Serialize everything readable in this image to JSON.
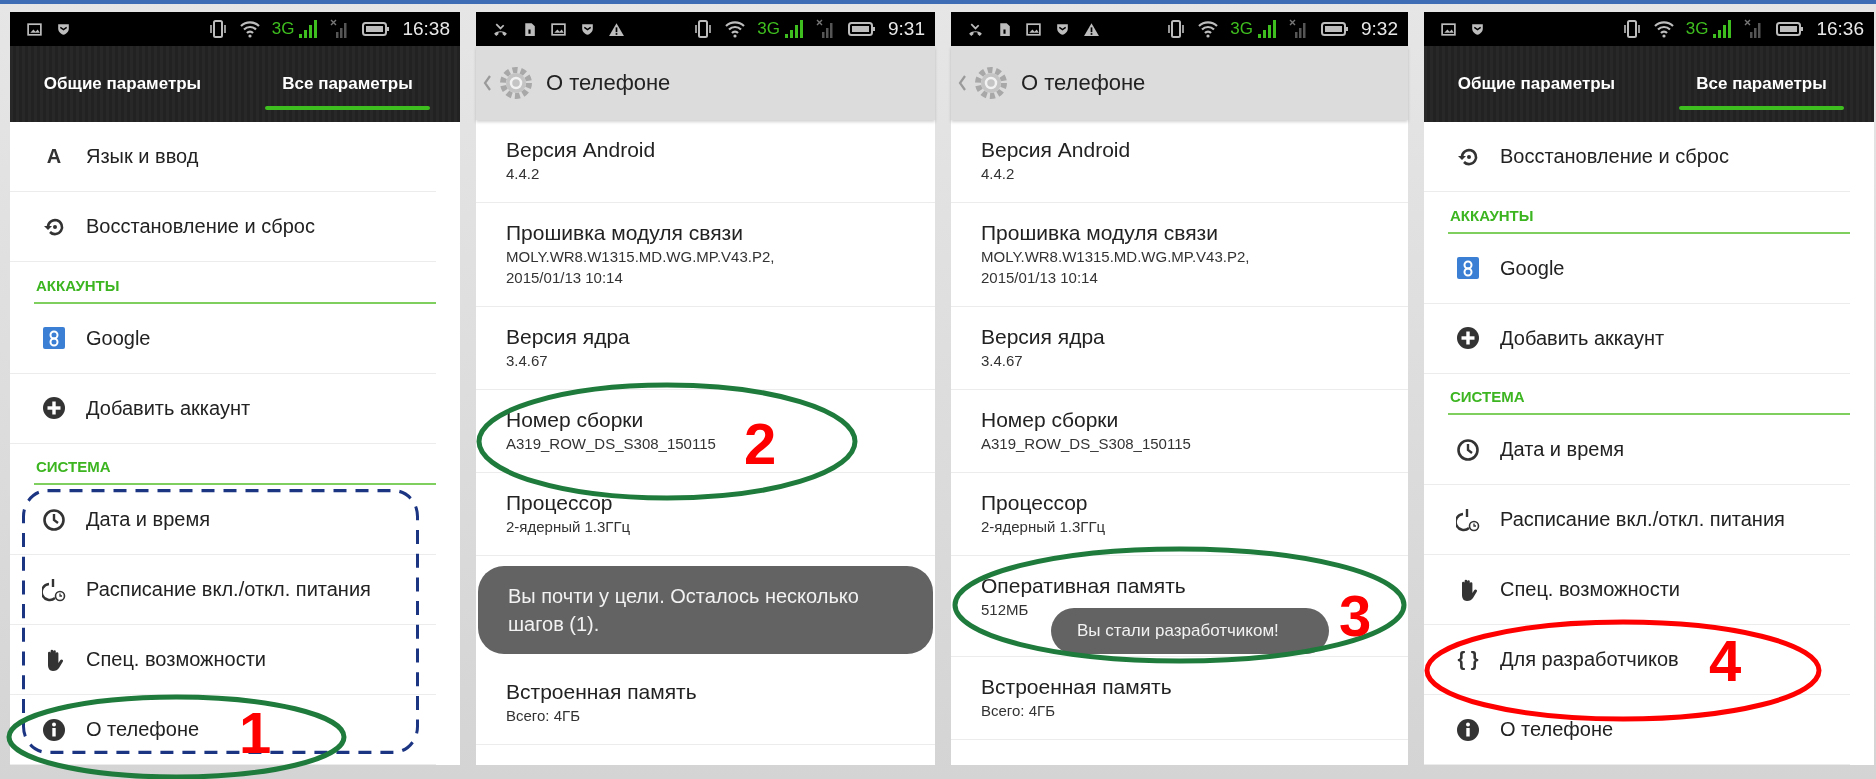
{
  "phones": [
    {
      "status_bar": {
        "notification_icons": [
          {
            "kind": "image"
          },
          {
            "kind": "shield"
          }
        ],
        "network": "3G",
        "time": "16:38"
      },
      "tabs": [
        {
          "label": "Общие параметры",
          "selected": false
        },
        {
          "label": "Все параметры",
          "selected": true
        }
      ],
      "items": [
        {
          "kind": "glyph",
          "glyph": "A",
          "label": "Язык и ввод"
        },
        {
          "kind": "restore",
          "label": "Восстановление и сброс"
        },
        {
          "kind": "section",
          "label": "АККАУНТЫ"
        },
        {
          "kind": "google",
          "label": "Google"
        },
        {
          "kind": "add",
          "label": "Добавить аккаунт"
        },
        {
          "kind": "section",
          "label": "СИСТЕМА"
        },
        {
          "kind": "group",
          "children": [
            {
              "kind": "clock",
              "label": "Дата и время"
            },
            {
              "kind": "schedule",
              "label": "Расписание вкл./откл. питания"
            },
            {
              "kind": "hand",
              "label": "Спец. возможности"
            },
            {
              "kind": "about",
              "label": "О телефоне",
              "annotation": {
                "color": "#1e7b3c",
                "number": "1"
              }
            }
          ]
        }
      ]
    },
    {
      "status_bar": {
        "notification_icons": [
          {
            "kind": "missed-call"
          },
          {
            "kind": "sd-card"
          },
          {
            "kind": "image"
          },
          {
            "kind": "shield"
          },
          {
            "kind": "warning"
          }
        ],
        "network": "3G",
        "time": "9:31"
      },
      "header": {
        "title": "О телефоне"
      },
      "items": [
        {
          "kind": "detail",
          "title": "Версия Android",
          "lines": [
            "4.4.2"
          ]
        },
        {
          "kind": "detail",
          "title": "Прошивка модуля связи",
          "lines": [
            "MOLY.WR8.W1315.MD.WG.MP.V43.P2,",
            "2015/01/13 10:14"
          ]
        },
        {
          "kind": "detail",
          "title": "Версия ядра",
          "lines": [
            "3.4.67"
          ]
        },
        {
          "kind": "detail",
          "title": "Номер сборки",
          "lines": [
            "A319_ROW_DS_S308_150115"
          ],
          "annotation": {
            "color": "#1e7b3c",
            "number": "2"
          }
        },
        {
          "kind": "detail",
          "title": "Процессор",
          "lines": [
            "2-ядерный 1.3ГГц"
          ]
        },
        {
          "kind": "toast",
          "text": "Вы почти у цели. Осталось несколько шагов (1)."
        },
        {
          "kind": "detail",
          "title": "Встроенная память",
          "lines": [
            "Всего: 4ГБ"
          ]
        }
      ]
    },
    {
      "status_bar": {
        "notification_icons": [
          {
            "kind": "missed-call"
          },
          {
            "kind": "sd-card"
          },
          {
            "kind": "image"
          },
          {
            "kind": "shield"
          },
          {
            "kind": "warning"
          }
        ],
        "network": "3G",
        "time": "9:32"
      },
      "header": {
        "title": "О телефоне"
      },
      "items": [
        {
          "kind": "detail",
          "title": "Версия Android",
          "lines": [
            "4.4.2"
          ]
        },
        {
          "kind": "detail",
          "title": "Прошивка модуля связи",
          "lines": [
            "MOLY.WR8.W1315.MD.WG.MP.V43.P2,",
            "2015/01/13 10:14"
          ]
        },
        {
          "kind": "detail",
          "title": "Версия ядра",
          "lines": [
            "3.4.67"
          ]
        },
        {
          "kind": "detail",
          "title": "Номер сборки",
          "lines": [
            "A319_ROW_DS_S308_150115"
          ]
        },
        {
          "kind": "detail",
          "title": "Процессор",
          "lines": [
            "2-ядерный 1.3ГГц"
          ]
        },
        {
          "kind": "detail",
          "title": "Оперативная память",
          "lines": [
            "512МБ"
          ],
          "toast": "Вы стали разработчиком!",
          "annotation": {
            "color": "#1e7b3c",
            "number": "3"
          }
        },
        {
          "kind": "detail",
          "title": "Встроенная память",
          "lines": [
            "Всего: 4ГБ"
          ]
        }
      ]
    },
    {
      "status_bar": {
        "notification_icons": [
          {
            "kind": "image"
          },
          {
            "kind": "shield"
          }
        ],
        "network": "3G",
        "time": "16:36"
      },
      "tabs": [
        {
          "label": "Общие параметры",
          "selected": false
        },
        {
          "label": "Все параметры",
          "selected": true
        }
      ],
      "items": [
        {
          "kind": "restore",
          "label": "Восстановление и сброс"
        },
        {
          "kind": "section",
          "label": "АККАУНТЫ"
        },
        {
          "kind": "google",
          "label": "Google"
        },
        {
          "kind": "add",
          "label": "Добавить аккаунт"
        },
        {
          "kind": "section",
          "label": "СИСТЕМА"
        },
        {
          "kind": "clock",
          "label": "Дата и время"
        },
        {
          "kind": "schedule",
          "label": "Расписание вкл./откл. питания"
        },
        {
          "kind": "hand",
          "label": "Спец. возможности"
        },
        {
          "kind": "glyph",
          "glyph": "{ }",
          "label": "Для разработчиков",
          "annotation": {
            "color": "#ff0000",
            "number": "4"
          }
        },
        {
          "kind": "about",
          "label": "О телефоне"
        }
      ]
    }
  ]
}
